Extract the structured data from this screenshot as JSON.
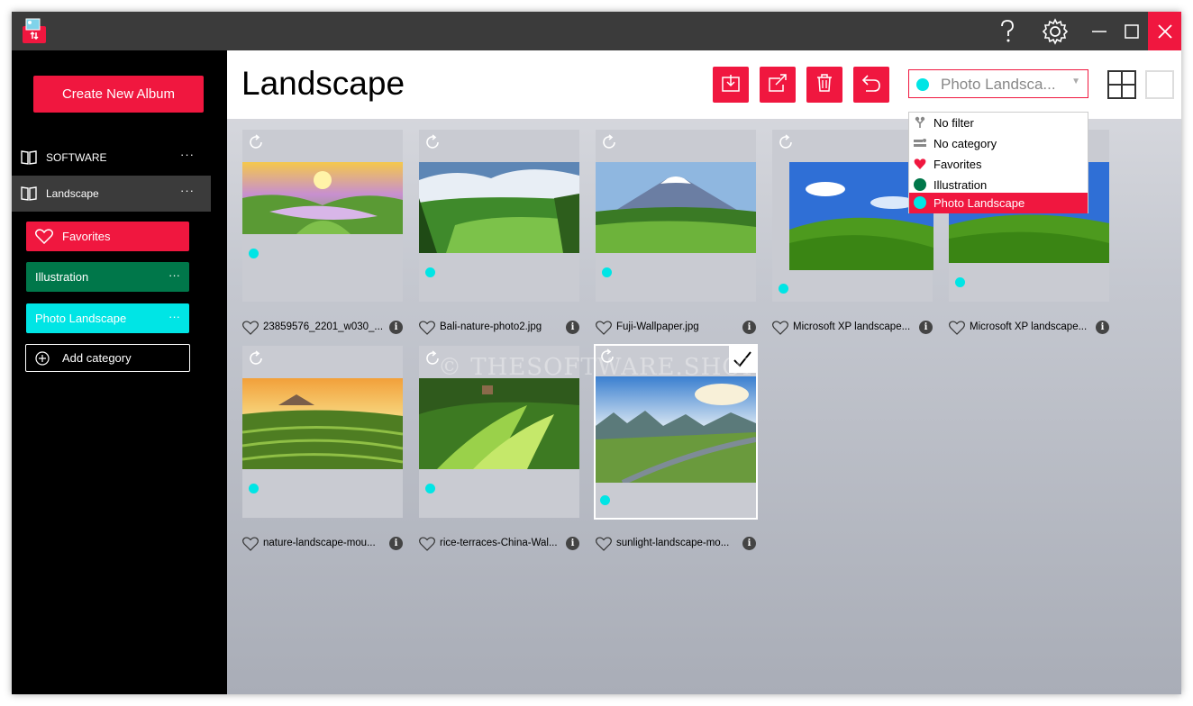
{
  "titlebar": {
    "icons": [
      "app-logo-icon",
      "help-icon",
      "gear-icon",
      "minimize-icon",
      "maximize-icon",
      "close-icon"
    ]
  },
  "sidebar": {
    "create_label": "Create New Album",
    "albums": [
      {
        "label": "SOFTWARE",
        "dots": "···"
      },
      {
        "label": "Landscape",
        "dots": "···"
      }
    ],
    "categories": [
      {
        "label": "Favorites",
        "color": "#f0173f"
      },
      {
        "label": "Illustration",
        "color": "#00774a",
        "dots": "···"
      },
      {
        "label": "Photo Landscape",
        "color": "#00e5e5",
        "dots": "···"
      }
    ],
    "add_category_label": "Add category"
  },
  "header": {
    "title": "Landscape",
    "filter_value": "Photo Landsca...",
    "actions": [
      "import-icon",
      "export-icon",
      "delete-icon",
      "undo-icon"
    ]
  },
  "dropdown": {
    "options": [
      {
        "label": "No filter",
        "icon": "filter-icon"
      },
      {
        "label": "No category",
        "icon": "category-icon"
      },
      {
        "label": "Favorites",
        "icon": "heart-icon",
        "color": "#f0173f"
      },
      {
        "label": "Illustration",
        "icon": "dot-icon",
        "color": "#00774a"
      },
      {
        "label": "Photo Landscape",
        "icon": "dot-icon",
        "color": "#00e5e5"
      }
    ],
    "selected": "Photo Landscape"
  },
  "images": [
    {
      "name": "23859576_2201_w030_..."
    },
    {
      "name": "Bali-nature-photo2.jpg"
    },
    {
      "name": "Fuji-Wallpaper.jpg"
    },
    {
      "name": "Microsoft XP landscape..."
    },
    {
      "name": "Microsoft XP landscape..."
    },
    {
      "name": "nature-landscape-mou..."
    },
    {
      "name": "rice-terraces-China-Wal..."
    },
    {
      "name": "sunlight-landscape-mo...",
      "selected": true
    }
  ],
  "info_glyph": "i",
  "watermark": "© THESOFTWARE.SHOP",
  "colors": {
    "accent": "#f0173f",
    "teal": "#00e5e5",
    "green": "#00774a",
    "titlebar": "#3b3b3b"
  }
}
